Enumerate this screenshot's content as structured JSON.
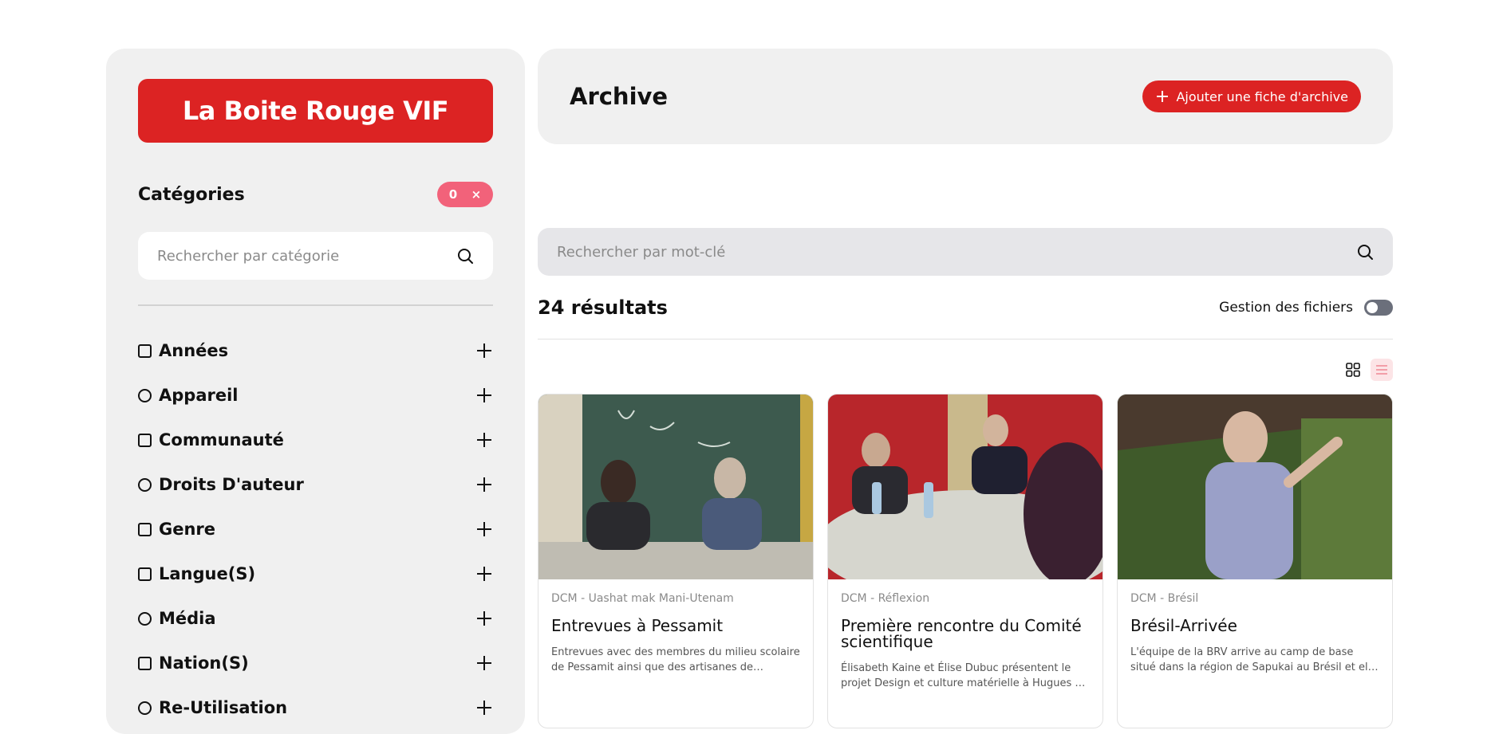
{
  "sidebar": {
    "brand": "La Boite Rouge VIF",
    "categories_title": "Catégories",
    "badge_count": "0",
    "badge_clear": "×",
    "search_placeholder": "Rechercher par catégorie",
    "filters": [
      {
        "label": "Années",
        "shape": "square"
      },
      {
        "label": "Appareil",
        "shape": "circle"
      },
      {
        "label": "Communauté",
        "shape": "square"
      },
      {
        "label": "Droits D'auteur",
        "shape": "circle"
      },
      {
        "label": "Genre",
        "shape": "square"
      },
      {
        "label": "Langue(S)",
        "shape": "square"
      },
      {
        "label": "Média",
        "shape": "circle"
      },
      {
        "label": "Nation(S)",
        "shape": "square"
      },
      {
        "label": "Re-Utilisation",
        "shape": "circle"
      }
    ]
  },
  "header": {
    "title": "Archive",
    "add_button": "Ajouter une fiche d'archive"
  },
  "search": {
    "placeholder": "Rechercher par mot-clé"
  },
  "results": {
    "count_label": "24 résultats",
    "file_mgmt_label": "Gestion des fichiers"
  },
  "cards": [
    {
      "category": "DCM - Uashat mak Mani-Utenam",
      "title": "Entrevues à Pessamit",
      "description": "Entrevues avec des membres du milieu scolaire de Pessamit ainsi que des artisanes de Uashat..."
    },
    {
      "category": "DCM - Réflexion",
      "title": "Première rencontre du Comité scientifique",
      "description": "Élisabeth Kaine et Élise Dubuc présentent le projet Design et culture matérielle à Hugues de Varine,..."
    },
    {
      "category": "DCM - Brésil",
      "title": "Brésil-Arrivée",
      "description": "L'équipe de la BRV arrive au camp de base situé dans la région de Sapukai au Brésil et elle travail..."
    }
  ],
  "colors": {
    "brand_red": "#dc2323",
    "badge_pink": "#f2627a",
    "panel_gray": "#f0f0f0"
  }
}
